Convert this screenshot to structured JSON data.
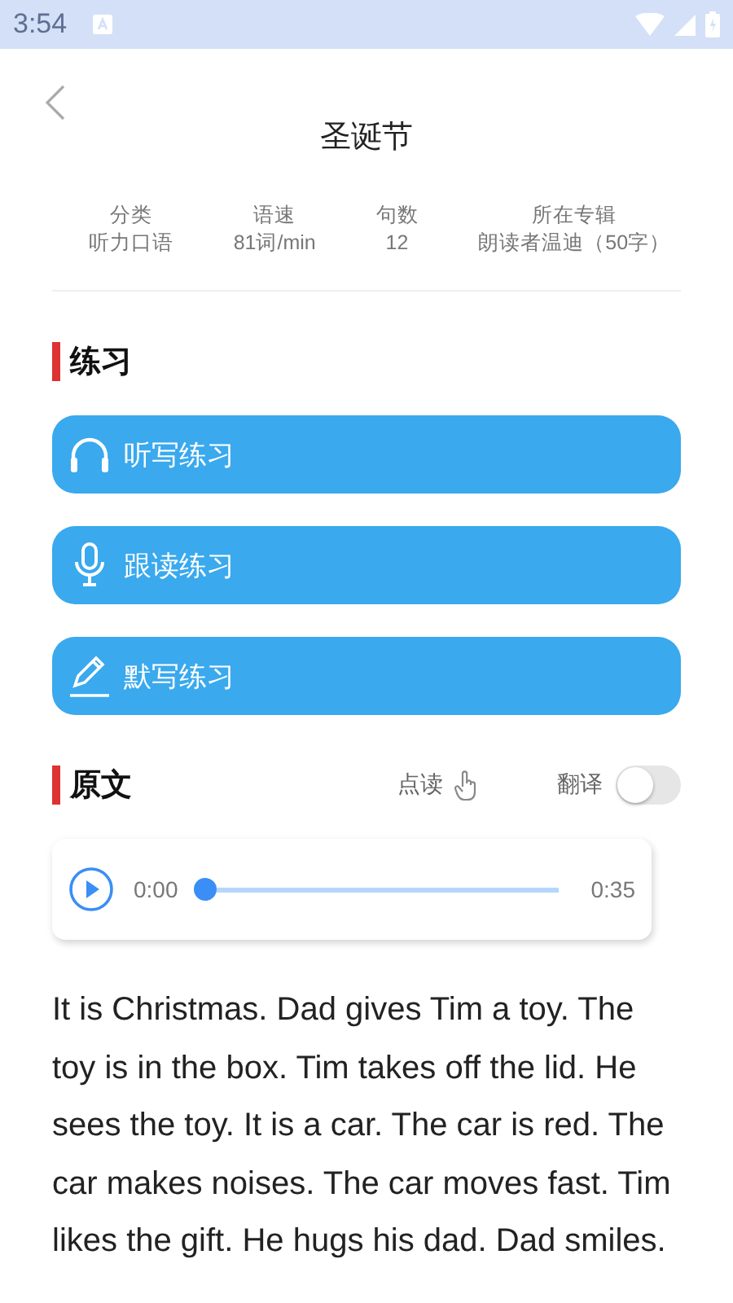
{
  "status_bar": {
    "time": "3:54"
  },
  "header": {
    "title": "圣诞节"
  },
  "stats": [
    {
      "label": "分类",
      "value": "听力口语"
    },
    {
      "label": "语速",
      "value": "81词/min"
    },
    {
      "label": "句数",
      "value": "12"
    },
    {
      "label": "所在专辑",
      "value": "朗读者温迪（50字）"
    }
  ],
  "practice": {
    "heading": "练习",
    "buttons": [
      {
        "kind": "headphones",
        "label": "听写练习"
      },
      {
        "kind": "microphone",
        "label": "跟读练习"
      },
      {
        "kind": "pencil",
        "label": "默写练习"
      }
    ]
  },
  "original": {
    "heading": "原文",
    "read_aloud": "点读",
    "translate": {
      "label": "翻译",
      "on": false
    }
  },
  "player": {
    "elapsed": "0:00",
    "duration": "0:35",
    "level": 0
  },
  "text": "It is Christmas. Dad gives Tim a toy. The toy is in the box. Tim takes off the lid. He sees the toy. It is a car. The car is red. The car makes noises. The car moves fast. Tim likes the gift. He hugs his dad. Dad smiles."
}
